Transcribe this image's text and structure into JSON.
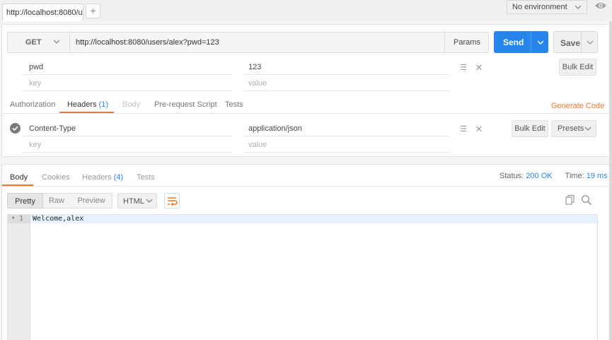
{
  "tabs": {
    "active_label": "http://localhost:8080/use",
    "add_label": "+"
  },
  "environment": {
    "selected": "No environment"
  },
  "request": {
    "method": "GET",
    "url": "http://localhost:8080/users/alex?pwd=123",
    "params_label": "Params",
    "send_label": "Send",
    "save_label": "Save"
  },
  "params": {
    "rows": [
      {
        "key": "pwd",
        "value": "123"
      }
    ],
    "key_placeholder": "key",
    "value_placeholder": "value",
    "bulk_edit_label": "Bulk Edit"
  },
  "request_tabs": {
    "authorization": "Authorization",
    "headers": "Headers",
    "headers_count": "(1)",
    "body": "Body",
    "pre_request": "Pre-request Script",
    "tests": "Tests",
    "generate_code": "Generate Code"
  },
  "headers": {
    "rows": [
      {
        "key": "Content-Type",
        "value": "application/json"
      }
    ],
    "key_placeholder": "key",
    "value_placeholder": "value",
    "bulk_edit_label": "Bulk Edit",
    "presets_label": "Presets"
  },
  "response": {
    "tabs": {
      "body": "Body",
      "cookies": "Cookies",
      "headers": "Headers",
      "headers_count": "(4)",
      "tests": "Tests"
    },
    "status_label": "Status:",
    "status_value": "200 OK",
    "time_label": "Time:",
    "time_value": "19 ms",
    "view_modes": [
      "Pretty",
      "Raw",
      "Preview"
    ],
    "format": "HTML",
    "line_number": "1",
    "fold_marker": "▾",
    "body_text": "Welcome,alex"
  },
  "colors": {
    "accent": "#2585ea",
    "orange": "#f0772c"
  }
}
